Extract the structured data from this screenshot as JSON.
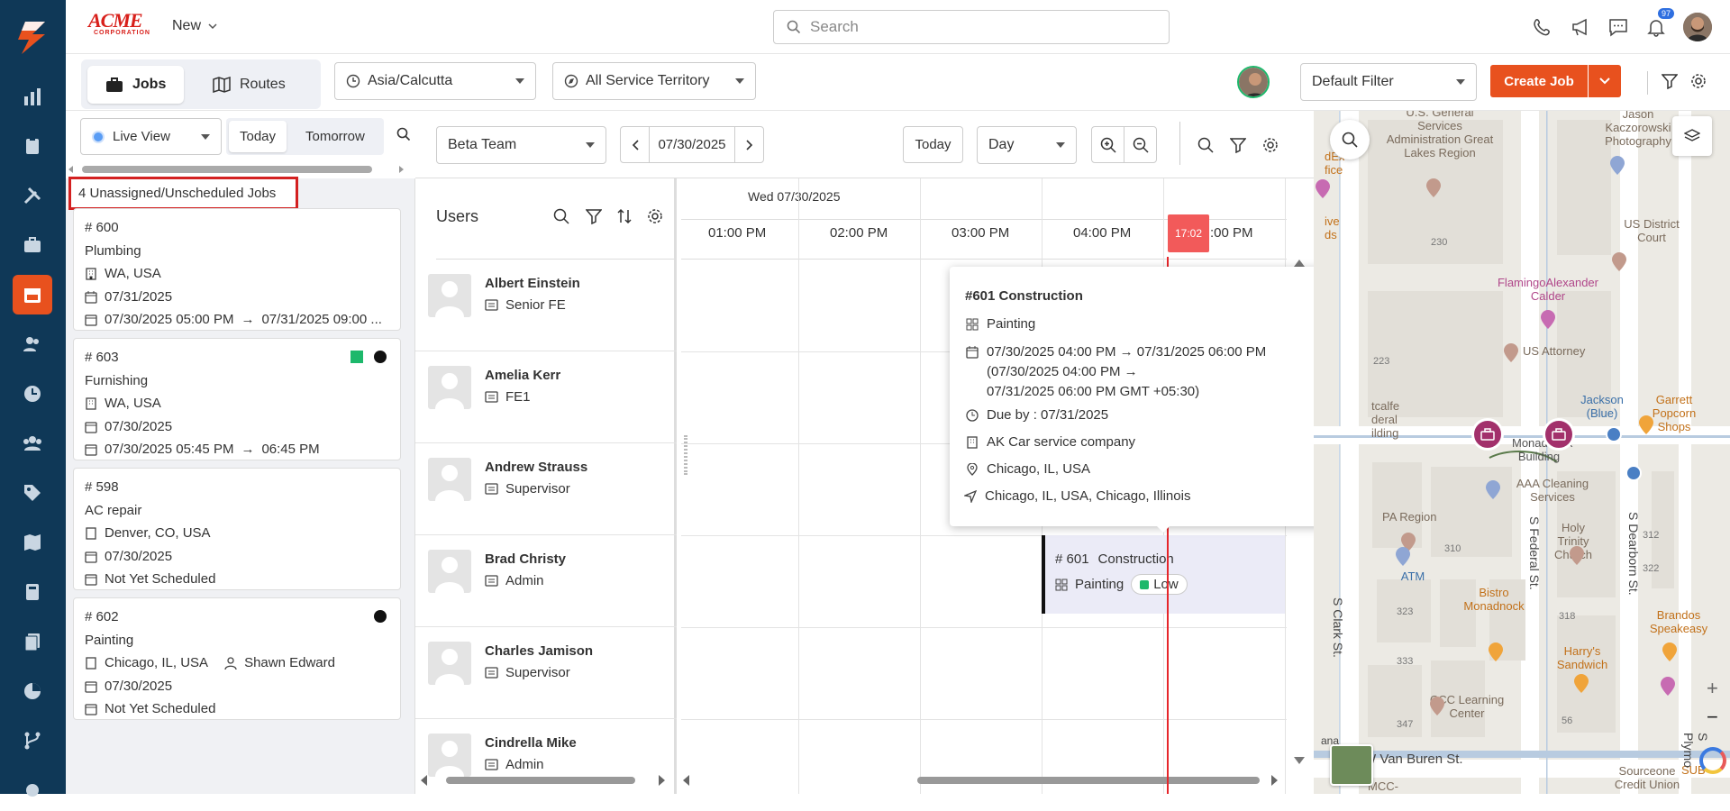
{
  "app": {
    "logo_text": "ACME",
    "logo_sub": "CORPORATION",
    "new_label": "New"
  },
  "search": {
    "placeholder": "Search"
  },
  "notifications": {
    "count": "97"
  },
  "tabs": [
    {
      "label": "Jobs"
    },
    {
      "label": "Routes"
    }
  ],
  "timezone": "Asia/Calcutta",
  "territory": "All Service Territory",
  "filter": {
    "default": "Default Filter"
  },
  "create_job": "Create Job",
  "left": {
    "view": "Live View",
    "day_tabs": [
      "Today",
      "Tomorrow"
    ],
    "unassigned_title": "4 Unassigned/Unscheduled Jobs",
    "jobs": [
      {
        "number": "# 600",
        "type": "Plumbing",
        "location": "WA, USA",
        "date": "07/31/2025",
        "range": "07/30/2025 05:00 PM",
        "range_end": "07/31/2025 09:00 ..."
      },
      {
        "number": "# 603",
        "type": "Furnishing",
        "location": "WA, USA",
        "date": "07/30/2025",
        "range": "07/30/2025 05:45 PM",
        "range_end": "06:45 PM"
      },
      {
        "number": "# 598",
        "type": "AC repair",
        "location": "Denver, CO, USA",
        "date": "07/30/2025",
        "status": "Not Yet Scheduled"
      },
      {
        "number": "# 602",
        "type": "Painting",
        "location": "Chicago, IL, USA",
        "assignee": "Shawn Edward",
        "date": "07/30/2025",
        "status": "Not Yet Scheduled"
      }
    ]
  },
  "scheduler": {
    "team": "Beta Team",
    "date": "07/30/2025",
    "today": "Today",
    "view": "Day",
    "users_title": "Users",
    "day_header": "Wed 07/30/2025",
    "times": [
      "01:00 PM",
      "02:00 PM",
      "03:00 PM",
      "04:00 PM",
      ":00 PM"
    ],
    "now_label": "17:02",
    "users": [
      {
        "name": "Albert Einstein",
        "role": "Senior FE"
      },
      {
        "name": "Amelia Kerr",
        "role": "FE1"
      },
      {
        "name": "Andrew Strauss",
        "role": "Supervisor"
      },
      {
        "name": "Brad Christy",
        "role": "Admin"
      },
      {
        "name": "Charles Jamison",
        "role": "Supervisor"
      },
      {
        "name": "Cindrella Mike",
        "role": "Admin"
      }
    ],
    "event": {
      "number": "# 601",
      "title": "Construction",
      "type": "Painting",
      "priority": "Low"
    },
    "popup": {
      "title": "#601 Construction",
      "type": "Painting",
      "time_line1": "07/30/2025 04:00 PM",
      "time_line1_end": "07/31/2025 06:00 PM",
      "time_line2": "(07/30/2025 04:00 PM",
      "time_line3": "07/31/2025 06:00 PM GMT +05:30)",
      "due": "Due by : 07/31/2025",
      "company": "AK Car service company",
      "location": "Chicago, IL, USA",
      "address": "Chicago, IL, USA, Chicago, Illinois"
    }
  },
  "map": {
    "labels": {
      "l1": "U.S. General Services Administration Great Lakes Region",
      "l2": "Jason Kaczorowski Photography",
      "l3": "US District Court",
      "l4": "FlamingoAlexander Calder",
      "l5": "US Attorney",
      "l6": "Jackson (Blue)",
      "l7": "Garrett Popcorn Shops",
      "l8": "AAA Cleaning Services",
      "l9": "Holy Trinity Church",
      "l10": "Bistro Monadnock",
      "l11": "Harry's Sandwich",
      "l12": "Brandos Speakeasy",
      "l13": "CCC Learning Center",
      "l14": "ATM",
      "l15": "PA Region",
      "l16": "Sourceone Credit Union",
      "l17": "Monadnock Building",
      "l18": "tcalfe deral ilding",
      "l19": "dEx fice",
      "l20": "ive ds",
      "l21": "MCC-",
      "l22": "SUB"
    },
    "numbers": [
      "230",
      "223",
      "310",
      "323",
      "318",
      "312",
      "322",
      "333",
      "347",
      "56"
    ],
    "streets": {
      "clark": "S Clark St.",
      "federal": "S Federal St.",
      "dearborn": "S Dearborn St.",
      "vanburen": "W Van Buren St.",
      "plymouth": "S Plymo",
      "ana": "ana"
    }
  },
  "colors": {
    "sidebar": "#0f3857",
    "accent": "#e8511e",
    "now_line": "#e6262b",
    "pin": "#a2306b",
    "ok": "#1db86b"
  }
}
